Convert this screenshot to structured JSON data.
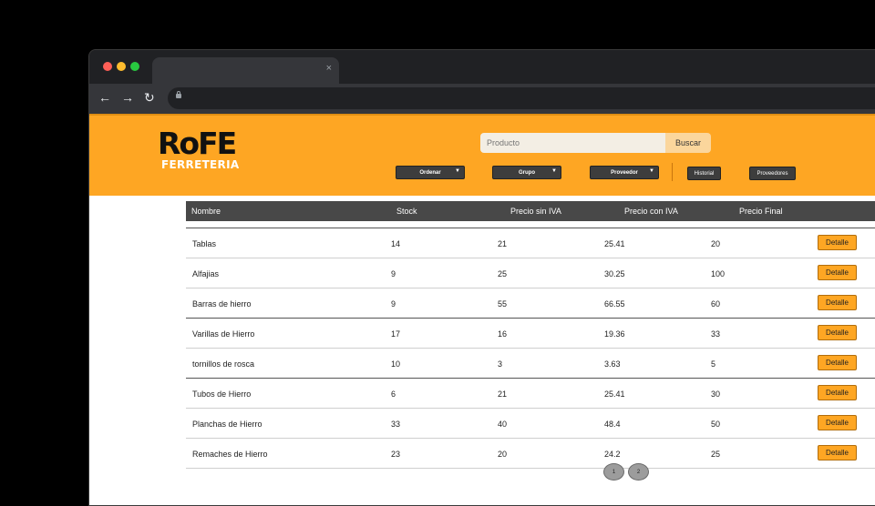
{
  "browser": {
    "tab_close": "×",
    "nav": {
      "back": "←",
      "forward": "→",
      "reload": "↻"
    }
  },
  "header": {
    "logo_top": "RoFE",
    "logo_bottom": "FERRETERIA",
    "search": {
      "placeholder": "Producto",
      "button": "Buscar"
    },
    "filters": {
      "ordenar": "Ordenar",
      "grupo": "Grupo",
      "proveedor": "Proveedor"
    },
    "historial": "Historial",
    "proveedores": "Proveedores",
    "colors": {
      "accent": "#fea623",
      "dark": "#484848"
    }
  },
  "table": {
    "headers": [
      "Nombre",
      "Stock",
      "Precio sin IVA",
      "Precio con IVA",
      "Precio Final"
    ],
    "detail_label": "Detalle",
    "rows": [
      {
        "nombre": "Tablas",
        "stock": "14",
        "sin_iva": "21",
        "con_iva": "25.41",
        "final": "20"
      },
      {
        "nombre": "Alfajias",
        "stock": "9",
        "sin_iva": "25",
        "con_iva": "30.25",
        "final": "100"
      },
      {
        "nombre": "Barras de hierro",
        "stock": "9",
        "sin_iva": "55",
        "con_iva": "66.55",
        "final": "60"
      },
      {
        "nombre": "Varillas de Hierro",
        "stock": "17",
        "sin_iva": "16",
        "con_iva": "19.36",
        "final": "33"
      },
      {
        "nombre": "tornillos de rosca",
        "stock": "10",
        "sin_iva": "3",
        "con_iva": "3.63",
        "final": "5"
      },
      {
        "nombre": "Tubos de Hierro",
        "stock": "6",
        "sin_iva": "21",
        "con_iva": "25.41",
        "final": "30"
      },
      {
        "nombre": "Planchas de Hierro",
        "stock": "33",
        "sin_iva": "40",
        "con_iva": "48.4",
        "final": "50"
      },
      {
        "nombre": "Remaches de Hierro",
        "stock": "23",
        "sin_iva": "20",
        "con_iva": "24.2",
        "final": "25"
      }
    ]
  },
  "pagination": [
    "1",
    "2"
  ]
}
